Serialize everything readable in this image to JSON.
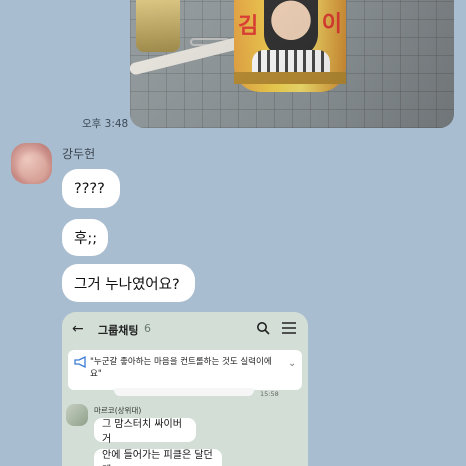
{
  "photo": {
    "cup_text_left": "김",
    "cup_text_right": "이"
  },
  "photo_time": "오후 3:48",
  "chat": {
    "sender": "강두헌",
    "messages": [
      "????",
      "후;;",
      "그거 누나였어요?"
    ]
  },
  "embedded": {
    "title": "그룹채팅",
    "member_count": "6",
    "notice": "\"누군갈 좋아하는 마음을 컨트롤하는 것도 실력이에요\"",
    "prev_time": "15:58",
    "member_name": "마르코(상위대)",
    "messages": [
      "그 맘스터치 싸이버거",
      "안에 들어가는 피클은 달던데"
    ]
  },
  "icons": {
    "back": "arrow-left-icon",
    "search": "search-icon",
    "menu": "hamburger-menu-icon",
    "notice": "megaphone-icon",
    "expand": "chevron-down-icon"
  },
  "colors": {
    "chat_bg": "#a9bdd0",
    "embedded_bg": "#d3dfd6",
    "bubble": "#ffffff"
  }
}
